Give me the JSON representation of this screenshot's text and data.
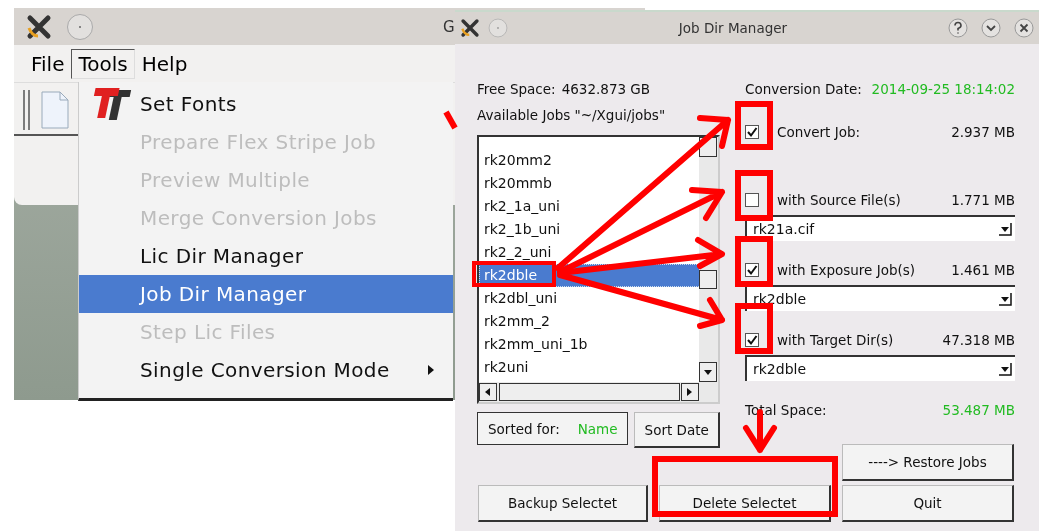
{
  "background_window": {
    "title": "G",
    "menubar": [
      {
        "label": "File",
        "selected": false
      },
      {
        "label": "Tools",
        "selected": true
      },
      {
        "label": "Help",
        "selected": false
      }
    ]
  },
  "tools_menu": {
    "items": [
      {
        "label": "Set Fonts",
        "kind": "icon",
        "disabled": false,
        "selected": false
      },
      {
        "label": "Prepare Flex Stripe Job",
        "kind": "plain",
        "disabled": true,
        "selected": false
      },
      {
        "label": "Preview Multiple",
        "kind": "plain",
        "disabled": true,
        "selected": false
      },
      {
        "label": "Merge Conversion Jobs",
        "kind": "plain",
        "disabled": true,
        "selected": false
      },
      {
        "label": "Lic Dir Manager",
        "kind": "plain",
        "disabled": false,
        "selected": false
      },
      {
        "label": "Job Dir Manager",
        "kind": "plain",
        "disabled": false,
        "selected": true
      },
      {
        "label": "Step Lic Files",
        "kind": "plain",
        "disabled": true,
        "selected": false
      },
      {
        "label": "Single Conversion Mode",
        "kind": "submenu",
        "disabled": false,
        "selected": false
      }
    ]
  },
  "dialog": {
    "title": "Job Dir Manager",
    "free_space": {
      "label": "Free Space:",
      "value": "4632.873 GB"
    },
    "jobs_label": "Available Jobs \"~/Xgui/jobs\"",
    "jobs": [
      {
        "name": "rk20mm2",
        "selected": false
      },
      {
        "name": "rk20mmb",
        "selected": false
      },
      {
        "name": "rk2_1a_uni",
        "selected": false
      },
      {
        "name": "rk2_1b_uni",
        "selected": false
      },
      {
        "name": "rk2_2_uni",
        "selected": false
      },
      {
        "name": "rk2dble",
        "selected": true
      },
      {
        "name": "rk2dbl_uni",
        "selected": false
      },
      {
        "name": "rk2mm_2",
        "selected": false
      },
      {
        "name": "rk2mm_uni_1b",
        "selected": false
      },
      {
        "name": "rk2uni",
        "selected": false
      }
    ],
    "sorted_for": {
      "label": "Sorted for:",
      "value": "Name"
    },
    "sort_button": "Sort Date",
    "conversion_date": {
      "label": "Conversion Date:",
      "value": "2014-09-25 18:14:02"
    },
    "options": [
      {
        "label": "Convert Job:",
        "size": "2.937 MB",
        "checked": true
      },
      {
        "label": "with Source File(s)",
        "size": "1.771 MB",
        "checked": false,
        "combo": "rk21a.cif"
      },
      {
        "label": "with Exposure Job(s)",
        "size": "1.461 MB",
        "checked": true,
        "combo": "rk2dble"
      },
      {
        "label": "with Target Dir(s)",
        "size": "47.318 MB",
        "checked": true,
        "combo": "rk2dble"
      }
    ],
    "total_space": {
      "label": "Total Space:",
      "value": "53.487 MB"
    },
    "restore_button": "---->   Restore Jobs",
    "buttons": [
      "Backup Selectet",
      "Delete Selectet",
      "Quit"
    ]
  }
}
